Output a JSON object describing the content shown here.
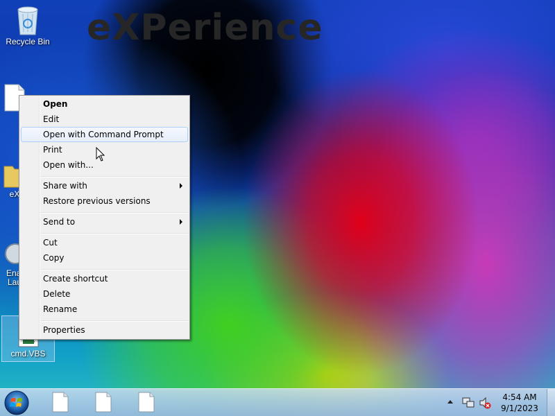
{
  "wallpaper": {
    "watermark_text": "eXPerience"
  },
  "desktop_icons": [
    {
      "name": "recycle-bin",
      "label": "Recycle Bin"
    },
    {
      "name": "text-file",
      "label": ""
    },
    {
      "name": "experience-folder",
      "label": "eX"
    },
    {
      "name": "enable-launcher",
      "label_line1": "Enal",
      "label_line2": "Lau"
    },
    {
      "name": "cmd-vbs",
      "label": "cmd.VBS",
      "selected": true
    }
  ],
  "context_menu": {
    "items": [
      {
        "label": "Open",
        "bold": true
      },
      {
        "label": "Edit"
      },
      {
        "label": "Open with Command Prompt",
        "highlighted": true
      },
      {
        "label": "Print"
      },
      {
        "label": "Open with..."
      },
      {
        "label": "Share with",
        "submenu": true
      },
      {
        "label": "Restore previous versions"
      },
      {
        "label": "Send to",
        "submenu": true
      },
      {
        "label": "Cut"
      },
      {
        "label": "Copy"
      },
      {
        "label": "Create shortcut"
      },
      {
        "label": "Delete"
      },
      {
        "label": "Rename"
      },
      {
        "label": "Properties"
      }
    ]
  },
  "taskbar": {
    "start_icon": "windows-orb-icon",
    "pinned": [
      "document-icon",
      "document-icon",
      "document-icon"
    ],
    "tray_icons": [
      "show-hidden-icons-arrow",
      "network-icon",
      "volume-muted-icon"
    ],
    "clock": {
      "time": "4:54 AM",
      "date": "9/1/2023"
    }
  },
  "colors": {
    "menu_bg": "#f0f0f0",
    "menu_highlight_border": "#aecff7",
    "taskbar": "#b4cde6"
  }
}
